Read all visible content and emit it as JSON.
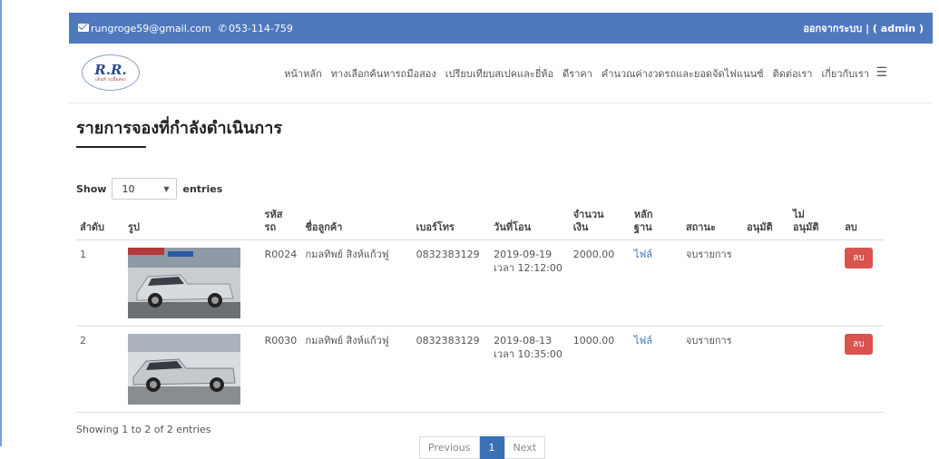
{
  "topbar": {
    "email": "rungroge59@gmail.com",
    "phone": "053-114-759",
    "logout": "ออกจากระบบ | ( admin )"
  },
  "logo": {
    "text": "R.R.",
    "subtext": "เต็นท์ รถมือสอง"
  },
  "menu": [
    "หน้าหลัก",
    "ทางเลือกค้นหารถมือสอง",
    "เปรียบเทียบสเปคและยี่ห้อ",
    "ดีราคา",
    "คำนวณค่างวดรถและยอดจัดไฟแนนซ์",
    "ติดต่อเรา",
    "เกี่ยวกับเรา"
  ],
  "page_title": "รายการจองที่กำลังดำเนินการ",
  "length": {
    "show": "Show",
    "value": "10",
    "entries": "entries"
  },
  "table": {
    "headers": [
      "ลำดับ",
      "รูป",
      "รหัส\nรถ",
      "ชื่อลูกค้า",
      "เบอร์โทร",
      "วันที่โอน",
      "จำนวน\nเงิน",
      "หลัก\nฐาน",
      "สถานะ",
      "อนุมัติ",
      "ไม่\nอนุมัติ",
      "ลบ"
    ],
    "rows": [
      {
        "no": "1",
        "code": "R0024",
        "name": "กมลทิพย์ สิงห์แก้วฟู",
        "phone": "0832383129",
        "date": "2019-09-19",
        "time": "เวลา 12:12:00",
        "amount": "2000.00",
        "file": "ไฟล์",
        "status": "จบรายการ",
        "delete": "ลบ"
      },
      {
        "no": "2",
        "code": "R0030",
        "name": "กมลทิพย์ สิงห์แก้วฟู",
        "phone": "0832383129",
        "date": "2019-08-13",
        "time": "เวลา 10:35:00",
        "amount": "1000.00",
        "file": "ไฟล์",
        "status": "จบรายการ",
        "delete": "ลบ"
      }
    ]
  },
  "info": "Showing 1 to 2 of 2 entries",
  "pager": {
    "prev": "Previous",
    "page": "1",
    "next": "Next"
  }
}
